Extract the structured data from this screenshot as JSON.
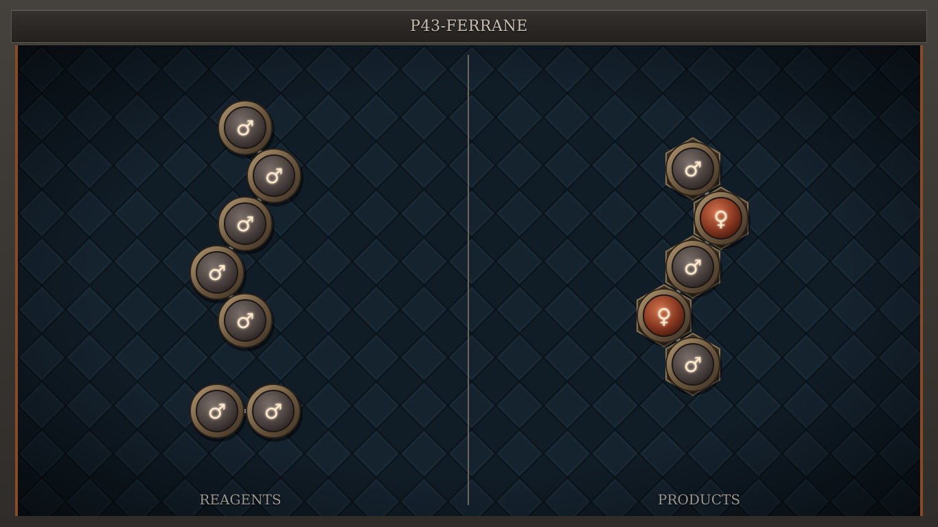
{
  "title": "P43-FERRANE",
  "panels": {
    "reagents_label": "REAGENTS",
    "products_label": "PRODUCTS"
  },
  "symbols": {
    "mars": "♂",
    "venus": "♀"
  },
  "colors": {
    "mars_atom": "#4e4542",
    "venus_atom": "#8b3a22",
    "frame_copper": "#8a4a25",
    "board_bg": "#0f1a23",
    "symbol_glow": "#ffe9cc"
  },
  "molecules": {
    "reagent_chain": [
      "mars",
      "mars",
      "mars",
      "mars",
      "mars"
    ],
    "reagent_pair": [
      "mars",
      "mars"
    ],
    "product_chain": [
      "mars",
      "venus",
      "mars",
      "venus",
      "mars"
    ]
  }
}
